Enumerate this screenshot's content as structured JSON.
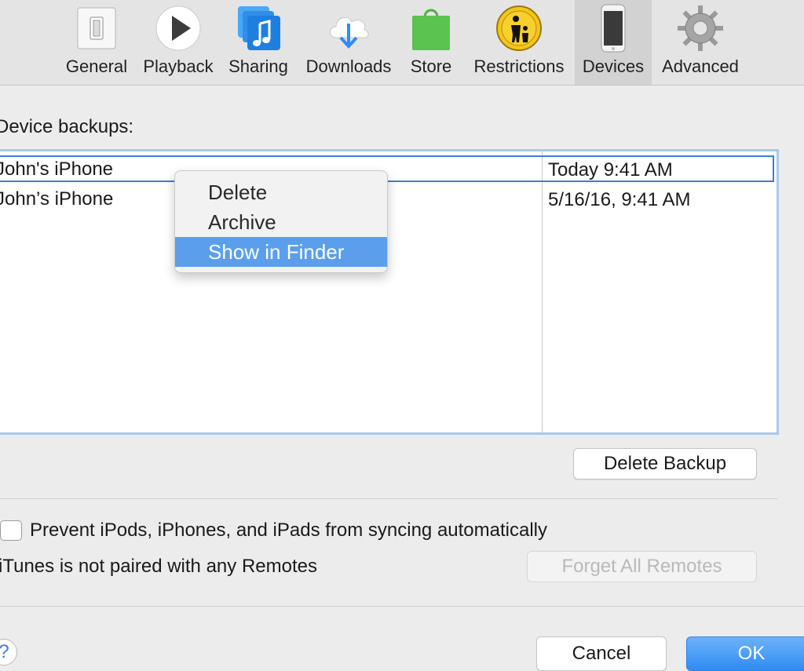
{
  "toolbar": {
    "tabs": [
      {
        "label": "General",
        "icon": "general-switch-icon"
      },
      {
        "label": "Playback",
        "icon": "play-icon"
      },
      {
        "label": "Sharing",
        "icon": "music-note-icon"
      },
      {
        "label": "Downloads",
        "icon": "cloud-download-icon"
      },
      {
        "label": "Store",
        "icon": "shopping-bag-icon"
      },
      {
        "label": "Restrictions",
        "icon": "parental-icon"
      },
      {
        "label": "Devices",
        "icon": "iphone-icon"
      },
      {
        "label": "Advanced",
        "icon": "gear-icon"
      }
    ],
    "active_tab": "Devices"
  },
  "backups": {
    "label": "Device backups:",
    "rows": [
      {
        "name": "John's iPhone",
        "date": "Today 9:41 AM",
        "selected": true
      },
      {
        "name": "John’s iPhone",
        "date": "5/16/16, 9:41 AM",
        "selected": false
      }
    ]
  },
  "context_menu": {
    "items": [
      "Delete",
      "Archive",
      "Show in Finder"
    ],
    "highlighted": "Show in Finder"
  },
  "buttons": {
    "delete_backup": "Delete Backup",
    "forget_remotes": "Forget All Remotes",
    "cancel": "Cancel",
    "ok": "OK",
    "help": "?"
  },
  "options": {
    "prevent_sync_label": "Prevent iPods, iPhones, and iPads from syncing automatically",
    "prevent_sync_checked": false,
    "remotes_status": "iTunes is not paired with any Remotes"
  },
  "colors": {
    "accent": "#3b7ed8",
    "highlight": "#5b9fec",
    "ok_button": "#2f8cf3"
  }
}
